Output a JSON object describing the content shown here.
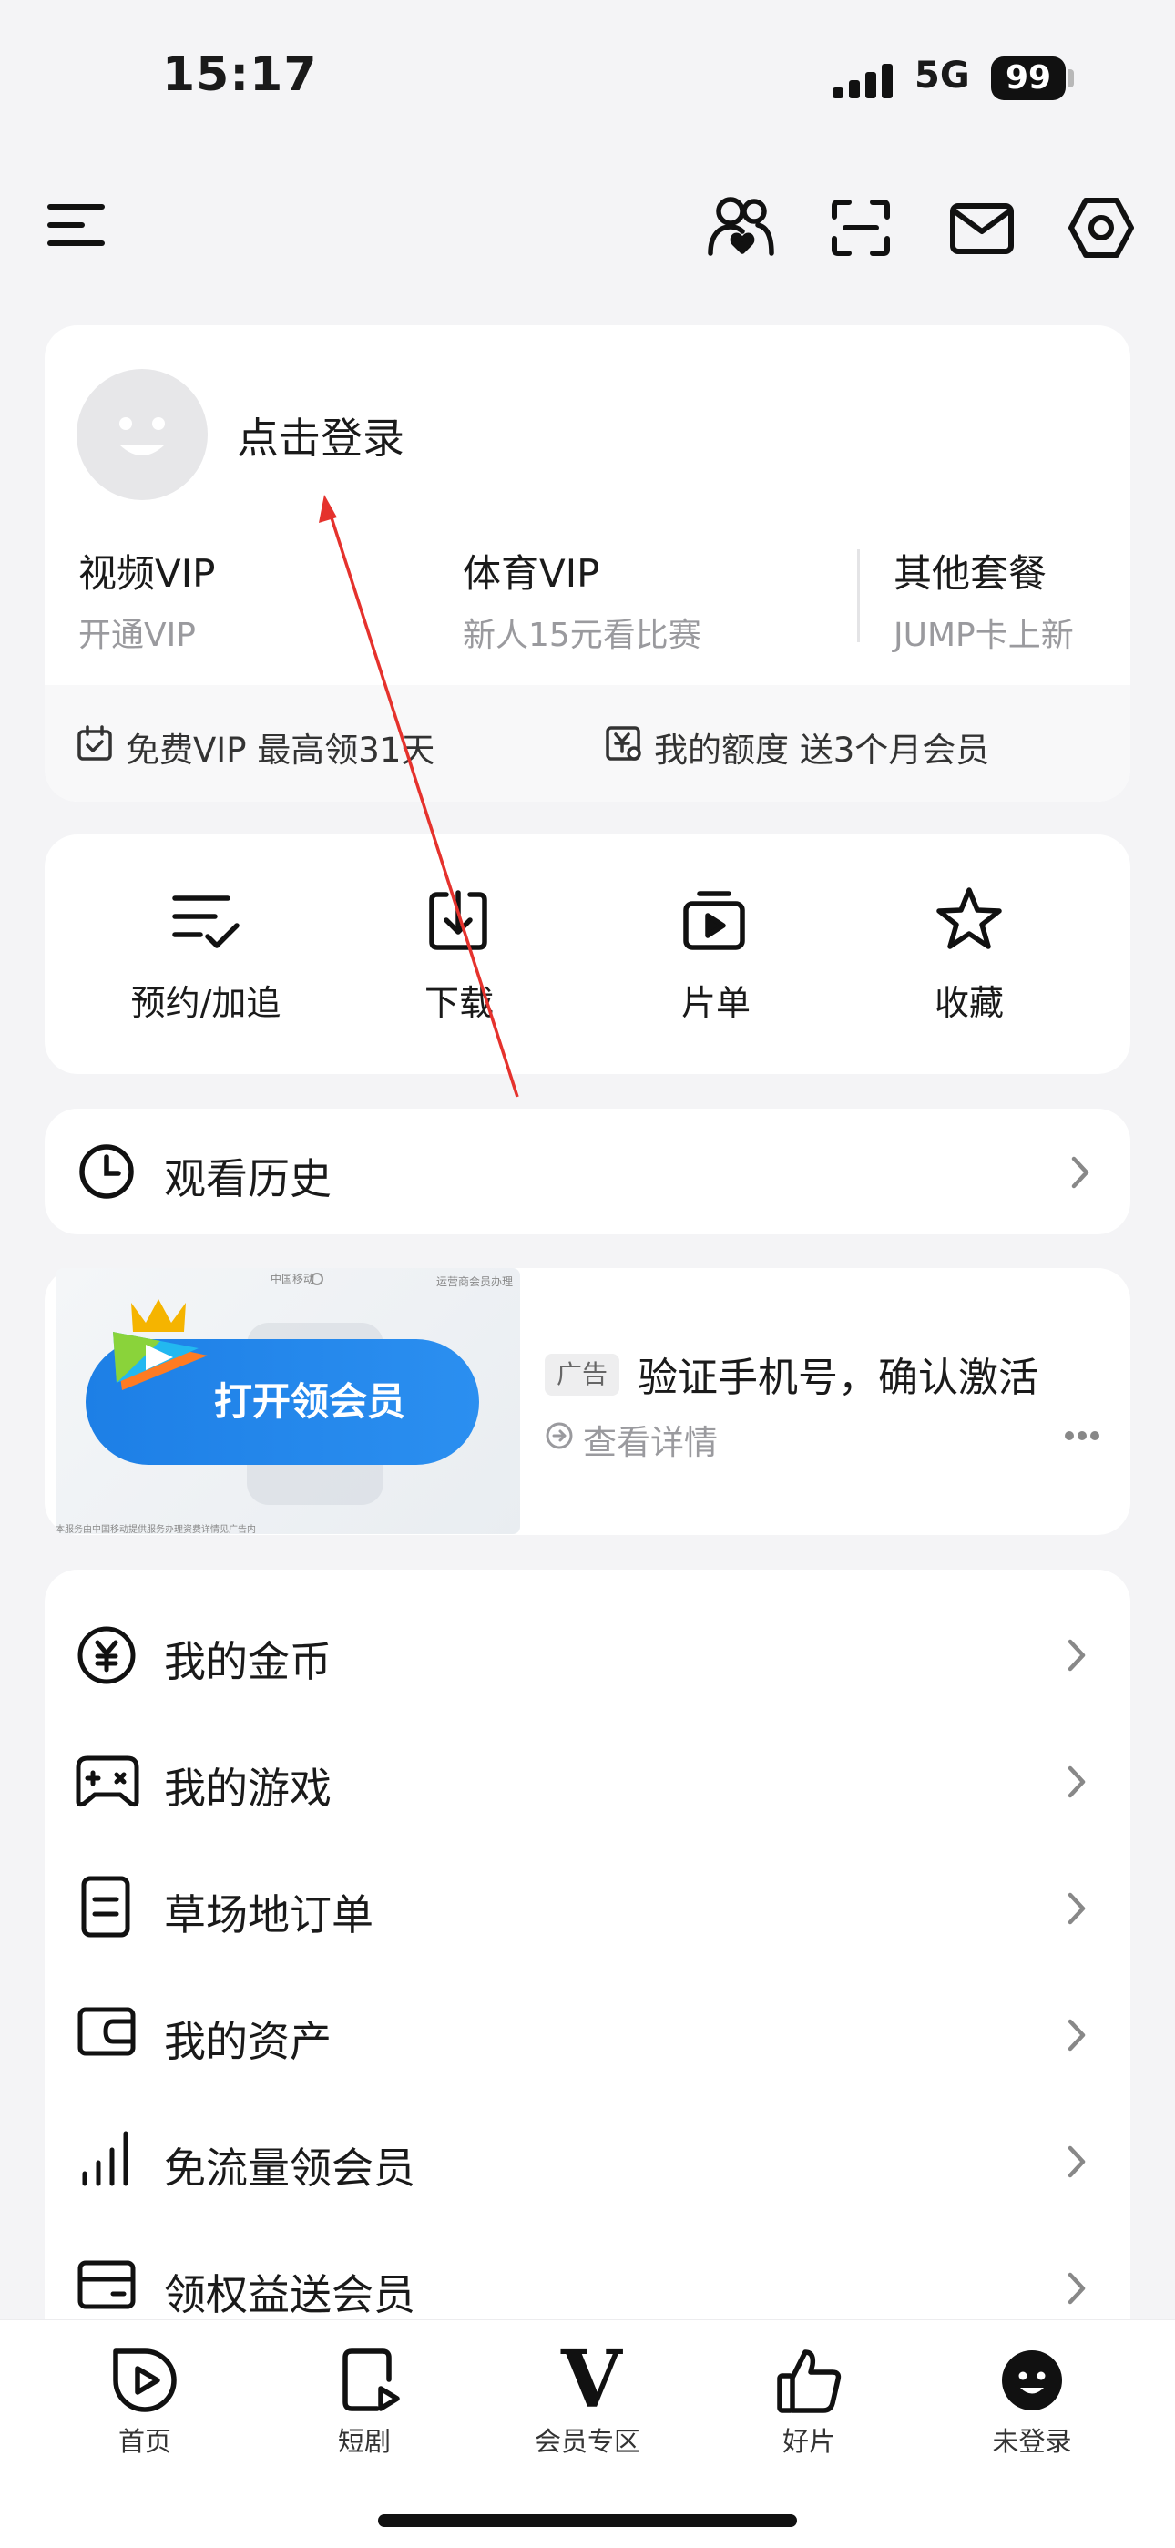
{
  "status_bar": {
    "time": "15:17",
    "network": "5G",
    "battery": "99"
  },
  "header_icons": [
    "menu-icon",
    "family-icon",
    "scan-icon",
    "mail-icon",
    "settings-icon"
  ],
  "login": {
    "prompt": "点击登录",
    "vip_items": [
      {
        "title": "视频VIP",
        "subtitle": "开通VIP"
      },
      {
        "title": "体育VIP",
        "subtitle": "新人15元看比赛"
      },
      {
        "title": "其他套餐",
        "subtitle": "JUMP卡上新"
      }
    ],
    "benefits": [
      {
        "label": "免费VIP 最高领31天"
      },
      {
        "label": "我的额度 送3个月会员"
      }
    ]
  },
  "quick_actions": [
    {
      "label": "预约/加追",
      "icon": "reserve-icon"
    },
    {
      "label": "下载",
      "icon": "download-icon"
    },
    {
      "label": "片单",
      "icon": "playlist-icon"
    },
    {
      "label": "收藏",
      "icon": "star-icon"
    }
  ],
  "history": {
    "label": "观看历史"
  },
  "ad": {
    "banner_button": "打开领会员",
    "tag": "广告",
    "title": "验证手机号，确认激活",
    "detail": "查看详情",
    "banner_top_text": "中国移动",
    "banner_top_right": "运营商会员办理",
    "banner_bottom_text": "本服务由中国移动提供服务办理资费详情见广告内"
  },
  "menu": [
    {
      "label": "我的金币",
      "icon": "coin-icon"
    },
    {
      "label": "我的游戏",
      "icon": "gamepad-icon"
    },
    {
      "label": "草场地订单",
      "icon": "order-icon"
    },
    {
      "label": "我的资产",
      "icon": "wallet-icon"
    },
    {
      "label": "免流量领会员",
      "icon": "signal-icon"
    },
    {
      "label": "领权益送会员",
      "icon": "card-icon"
    }
  ],
  "tabs": [
    {
      "label": "首页",
      "icon": "home-play-icon"
    },
    {
      "label": "短剧",
      "icon": "short-drama-icon"
    },
    {
      "label": "会员专区",
      "icon": "vip-v-icon",
      "glyph": "V"
    },
    {
      "label": "好片",
      "icon": "thumbs-up-icon"
    },
    {
      "label": "未登录",
      "icon": "avatar-icon"
    }
  ],
  "colors": {
    "background": "#f4f4f6",
    "card": "#ffffff",
    "ad_button": "#1d7fe6",
    "annotation_arrow": "#e5322d"
  }
}
